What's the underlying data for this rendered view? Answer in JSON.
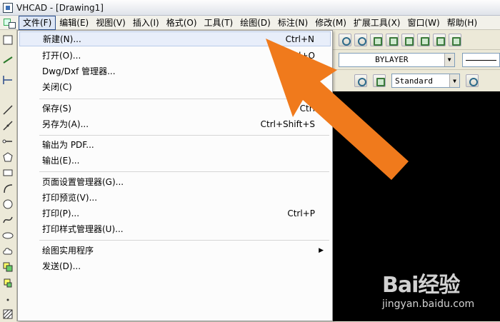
{
  "window": {
    "title": "VHCAD - [Drawing1]"
  },
  "menubar": {
    "items": [
      {
        "label": "文件(F)",
        "active": true
      },
      {
        "label": "编辑(E)"
      },
      {
        "label": "视图(V)"
      },
      {
        "label": "插入(I)"
      },
      {
        "label": "格式(O)"
      },
      {
        "label": "工具(T)"
      },
      {
        "label": "绘图(D)"
      },
      {
        "label": "标注(N)"
      },
      {
        "label": "修改(M)"
      },
      {
        "label": "扩展工具(X)"
      },
      {
        "label": "窗口(W)"
      },
      {
        "label": "帮助(H)"
      }
    ]
  },
  "file_menu": {
    "items": [
      {
        "label": "新建(N)...",
        "shortcut": "Ctrl+N"
      },
      {
        "label": "打开(O)...",
        "shortcut": "Ctrl+O"
      },
      {
        "label": "Dwg/Dxf 管理器..."
      },
      {
        "label": "关闭(C)"
      },
      {
        "label": "保存(S)",
        "shortcut": "Ctrl"
      },
      {
        "label": "另存为(A)...",
        "shortcut": "Ctrl+Shift+S"
      },
      {
        "label": "输出为 PDF..."
      },
      {
        "label": "输出(E)..."
      },
      {
        "label": "页面设置管理器(G)..."
      },
      {
        "label": "打印预览(V)..."
      },
      {
        "label": "打印(P)...",
        "shortcut": "Ctrl+P"
      },
      {
        "label": "打印样式管理器(U)..."
      },
      {
        "label": "绘图实用程序"
      },
      {
        "label": "发送(D)..."
      }
    ]
  },
  "toolbar": {
    "layer_combo": "BYLAYER",
    "text_style_combo": "Standard"
  },
  "watermark": {
    "logo": "Bai经验",
    "url": "jingyan.baidu.com"
  },
  "colors": {
    "arrow": "#f07a1c",
    "canvas": "#000000",
    "highlight": "#e8eefa"
  }
}
